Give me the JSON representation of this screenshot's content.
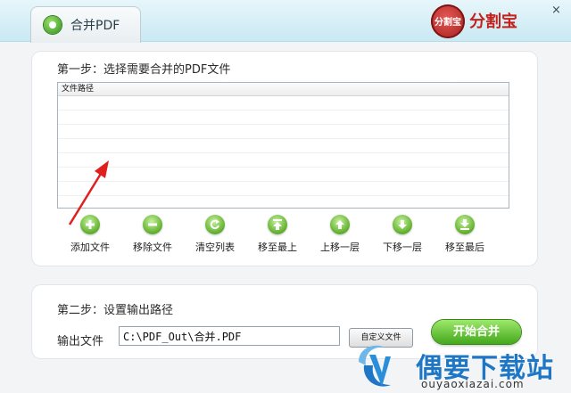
{
  "window": {
    "tab_label": "合并PDF",
    "brand_logo_text": "分割宝",
    "brand_name": "分割宝",
    "close_symbol": "×"
  },
  "step1": {
    "title": "第一步：选择需要合并的PDF文件",
    "file_list": {
      "columns": [
        "文件路径"
      ],
      "rows": []
    }
  },
  "toolbar": [
    {
      "icon": "plus-icon",
      "label": "添加文件"
    },
    {
      "icon": "minus-icon",
      "label": "移除文件"
    },
    {
      "icon": "refresh-icon",
      "label": "清空列表"
    },
    {
      "icon": "move-top-icon",
      "label": "移至最上"
    },
    {
      "icon": "arrow-up-icon",
      "label": "上移一层"
    },
    {
      "icon": "arrow-down-icon",
      "label": "下移一层"
    },
    {
      "icon": "move-bottom-icon",
      "label": "移至最后"
    }
  ],
  "step2": {
    "title": "第二步：设置输出路径",
    "output_label": "输出文件",
    "output_path": "C:\\PDF_Out\\合并.PDF",
    "custom_button": "自定义文件"
  },
  "start_button": "开始合并",
  "watermark": {
    "name": "偶要下载站",
    "url": "ouyaoxiazai.com"
  },
  "colors": {
    "accent_green": "#43a81c",
    "brand_red": "#c4211d",
    "watermark_blue": "#1e76c4"
  }
}
